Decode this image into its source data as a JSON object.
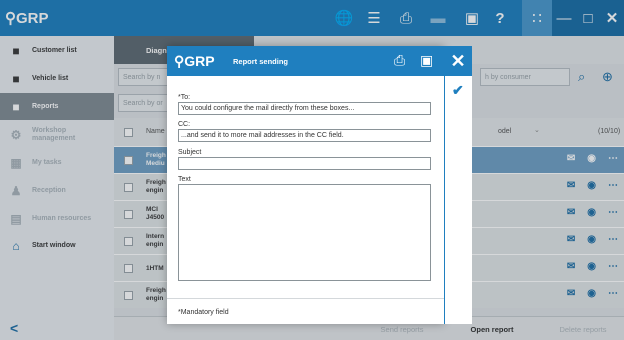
{
  "app": {
    "logo": "GRP"
  },
  "topbar": {
    "icons": [
      "globe-icon",
      "list-icon",
      "printer-icon",
      "truck-icon",
      "camera-icon",
      "help-icon",
      "grid-icon",
      "minimize-icon",
      "maximize-icon",
      "close-icon"
    ],
    "help_glyph": "?",
    "min_glyph": "—",
    "close_glyph": "✕"
  },
  "sidebar": {
    "items": [
      {
        "label": "Customer list",
        "icon": "customer-icon",
        "state": "normal"
      },
      {
        "label": "Vehicle list",
        "icon": "vehicle-icon",
        "state": "normal"
      },
      {
        "label": "Reports",
        "icon": "reports-icon",
        "state": "selected"
      },
      {
        "label": "Workshop management",
        "icon": "workshop-icon",
        "state": "dim"
      },
      {
        "label": "My tasks",
        "icon": "tasks-icon",
        "state": "dim"
      },
      {
        "label": "Reception",
        "icon": "reception-icon",
        "state": "dim"
      },
      {
        "label": "Human resources",
        "icon": "hr-icon",
        "state": "dim"
      },
      {
        "label": "Start window",
        "icon": "home-icon",
        "state": "normal"
      }
    ],
    "back_glyph": "<"
  },
  "main": {
    "tab_label": "Diagn",
    "search1_placeholder": "Search by n",
    "search2_placeholder": "Search by or",
    "search_customer_placeholder": "h by consumer",
    "header_name": "Name",
    "header_model": "odel",
    "header_count": "(10/10)",
    "rows": [
      {
        "name": "Freigh Mediu",
        "selected": true
      },
      {
        "name": "Freigh engin",
        "selected": false
      },
      {
        "name": "MCI J4500",
        "selected": false
      },
      {
        "name": "Intern engin",
        "selected": false
      },
      {
        "name": "1HTM",
        "selected": false
      },
      {
        "name": "Freigh engin",
        "selected": false
      }
    ],
    "row_actions": [
      "mail-icon",
      "eye-icon",
      "more-icon"
    ],
    "bottom_buttons": {
      "send": "Send reports",
      "open": "Open report",
      "delete": "Delete reports"
    }
  },
  "dialog": {
    "logo": "GRP",
    "title": "Report sending",
    "to_label": "*To:",
    "to_value": "You could configure the mail directly from these boxes...",
    "cc_label": "CC:",
    "cc_value": "...and send it to more mail addresses in the CC field.",
    "subject_label": "Subject",
    "subject_value": "",
    "text_label": "Text",
    "text_value": "",
    "mandatory_note": "*Mandatory field",
    "close_glyph": "✕",
    "confirm_glyph": "✔"
  },
  "colors": {
    "primary": "#1f7fbf",
    "sidebar_selected": "#808b93"
  }
}
